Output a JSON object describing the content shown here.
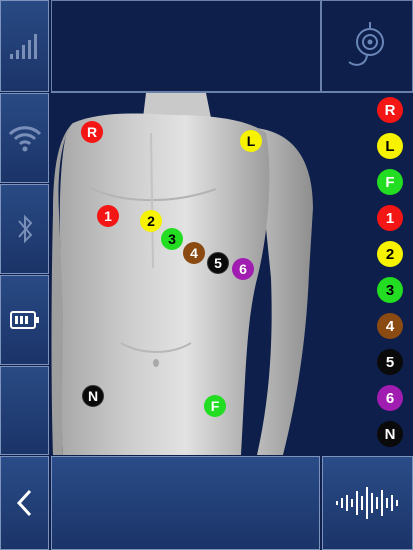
{
  "sidebar": {
    "items": [
      {
        "name": "signal-strength",
        "icon": "signal-bars-icon"
      },
      {
        "name": "wifi",
        "icon": "wifi-icon"
      },
      {
        "name": "bluetooth",
        "icon": "bluetooth-icon"
      },
      {
        "name": "battery",
        "icon": "battery-icon"
      },
      {
        "name": "empty",
        "icon": ""
      }
    ]
  },
  "header": {
    "icon": "stethoscope-probe-icon"
  },
  "colors": {
    "red": "#f41515",
    "yellow": "#f6f200",
    "green": "#22dd22",
    "brown": "#8a4a12",
    "black": "#0a0a0a",
    "purple": "#a11cb0"
  },
  "body_electrodes": [
    {
      "label": "R",
      "color": "#f41515",
      "text_color": "#ffffff"
    },
    {
      "label": "L",
      "color": "#f6f200",
      "text_color": "#000000"
    },
    {
      "label": "1",
      "color": "#f41515",
      "text_color": "#ffffff"
    },
    {
      "label": "2",
      "color": "#f6f200",
      "text_color": "#000000"
    },
    {
      "label": "3",
      "color": "#22dd22",
      "text_color": "#000000"
    },
    {
      "label": "4",
      "color": "#8a4a12",
      "text_color": "#ffffff"
    },
    {
      "label": "5",
      "color": "#0a0a0a",
      "text_color": "#ffffff"
    },
    {
      "label": "6",
      "color": "#a11cb0",
      "text_color": "#ffffff"
    },
    {
      "label": "N",
      "color": "#0a0a0a",
      "text_color": "#ffffff"
    },
    {
      "label": "F",
      "color": "#22dd22",
      "text_color": "#ffffff"
    }
  ],
  "legend": [
    {
      "label": "R",
      "color": "#f41515",
      "text_color": "#ffffff"
    },
    {
      "label": "L",
      "color": "#f6f200",
      "text_color": "#000000"
    },
    {
      "label": "F",
      "color": "#22dd22",
      "text_color": "#ffffff"
    },
    {
      "label": "1",
      "color": "#f41515",
      "text_color": "#ffffff"
    },
    {
      "label": "2",
      "color": "#f6f200",
      "text_color": "#000000"
    },
    {
      "label": "3",
      "color": "#22dd22",
      "text_color": "#000000"
    },
    {
      "label": "4",
      "color": "#8a4a12",
      "text_color": "#ffffff"
    },
    {
      "label": "5",
      "color": "#0a0a0a",
      "text_color": "#ffffff"
    },
    {
      "label": "6",
      "color": "#a11cb0",
      "text_color": "#ffffff"
    },
    {
      "label": "N",
      "color": "#0a0a0a",
      "text_color": "#ffffff"
    }
  ],
  "bottom": {
    "back_icon": "chevron-left-icon",
    "waveform_icon": "audio-waveform-icon"
  }
}
